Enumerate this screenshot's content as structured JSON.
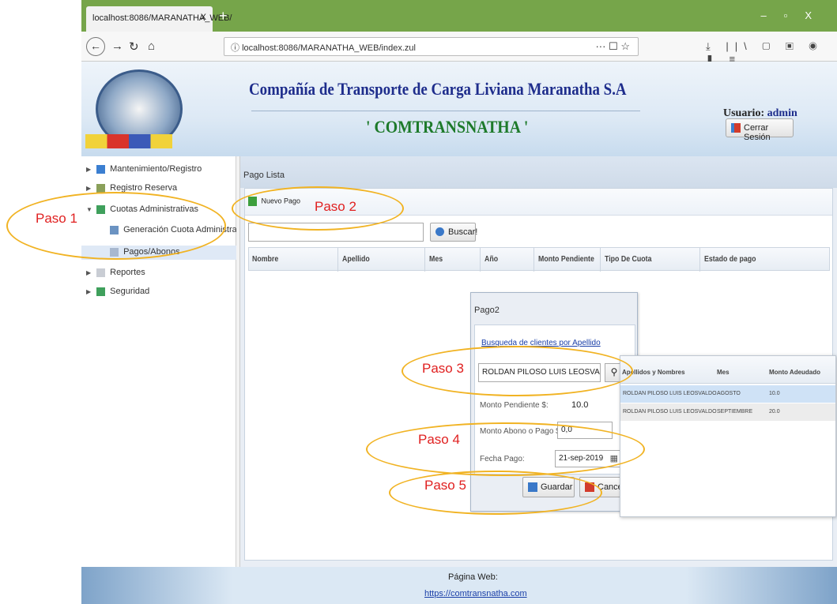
{
  "browser": {
    "tab_title": "localhost:8086/MARANATHA_WEB/",
    "tab_close": "X",
    "new_tab": "+",
    "url": "localhost:8086/MARANATHA_WEB/index.zul",
    "url_info_icon": "info-icon",
    "url_actions": "··· ☐ ☆"
  },
  "header": {
    "title": "Compañía de Transporte de Carga Liviana Maranatha S.A",
    "subtitle": "' COMTRANSNATHA '",
    "user_label": "Usuario:",
    "user_value": "admin",
    "logout_label": "Cerrar Sesión"
  },
  "sidebar": {
    "items": [
      {
        "label": "Mantenimiento/Registro",
        "icon": "config-icon"
      },
      {
        "label": "Registro Reserva",
        "icon": "register-icon"
      },
      {
        "label": "Cuotas Administrativas",
        "icon": "quota-icon"
      },
      {
        "label": "Generación Cuota Administrativa",
        "icon": "gen-icon"
      },
      {
        "label": "Pagos/Abonos",
        "icon": "pay-icon"
      },
      {
        "label": "Reportes",
        "icon": "report-icon"
      },
      {
        "label": "Seguridad",
        "icon": "security-icon"
      }
    ]
  },
  "main": {
    "panel_title": "Pago Lista",
    "new_button": "Nuevo Pago",
    "search_button": "Buscar!",
    "columns": [
      "Nombre",
      "Apellido",
      "Mes",
      "Año",
      "Monto Pendiente",
      "Tipo De Cuota",
      "Estado de pago"
    ]
  },
  "dialog": {
    "title": "Pago2",
    "search_link": "Busqueda de clientes por Apellido",
    "client_value": "ROLDAN PILOSO LUIS LEOSVALDO",
    "pending_label": "Monto Pendiente $:",
    "pending_value": "10.0",
    "abono_label": "Monto Abono o Pago $:",
    "abono_value": "0,0",
    "fecha_label": "Fecha Pago:",
    "fecha_value": "21-sep-2019",
    "save_button": "Guardar",
    "cancel_button": "Cancela"
  },
  "popup": {
    "columns": [
      "Apellidos y Nombres",
      "Mes",
      "Monto Adeudado"
    ],
    "rows": [
      {
        "name": "ROLDAN PILOSO LUIS LEOSVALDO",
        "mes": "AGOSTO",
        "monto": "10.0"
      },
      {
        "name": "ROLDAN PILOSO LUIS LEOSVALDO",
        "mes": "SEPTIEMBRE",
        "monto": "20.0"
      }
    ]
  },
  "footer": {
    "label": "Página Web:",
    "link": "https://comtransnatha.com"
  },
  "annotations": {
    "paso1": "Paso 1",
    "paso2": "Paso 2",
    "paso3": "Paso 3",
    "paso4": "Paso 4",
    "paso5": "Paso 5"
  },
  "colors": {
    "annotation": "#f1b323",
    "annotation_text": "#e02020",
    "title_blue": "#1e2d8c",
    "subtitle_green": "#1d7a2a"
  }
}
